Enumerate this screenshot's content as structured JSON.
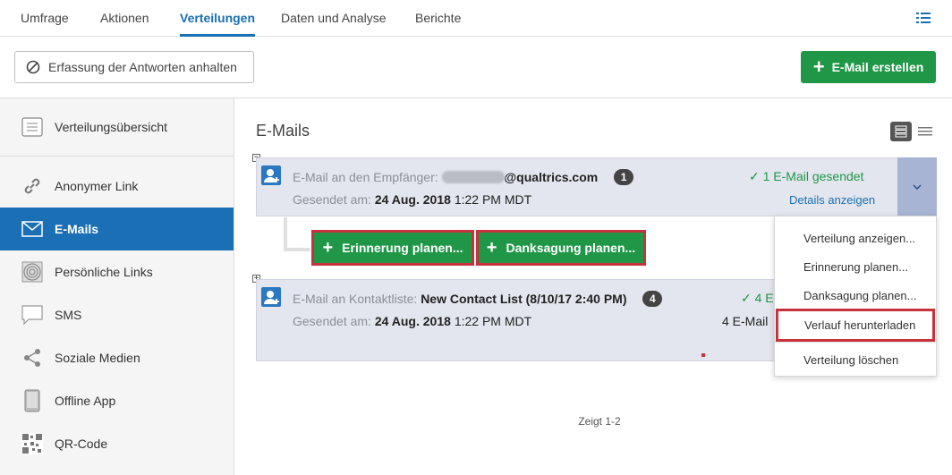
{
  "topnav": {
    "tabs": [
      {
        "label": "Umfrage"
      },
      {
        "label": "Aktionen"
      },
      {
        "label": "Verteilungen"
      },
      {
        "label": "Daten und Analyse"
      },
      {
        "label": "Berichte"
      }
    ],
    "active_tab": "Verteilungen"
  },
  "actionbar": {
    "stop_label": "Erfassung der Antworten anhalten",
    "create_label": "E-Mail erstellen"
  },
  "sidebar": {
    "items": [
      {
        "label": "Verteilungsübersicht",
        "icon": "document-list-icon"
      },
      {
        "label": "Anonymer Link",
        "icon": "link-icon"
      },
      {
        "label": "E-Mails",
        "icon": "envelope-icon",
        "active": true
      },
      {
        "label": "Persönliche Links",
        "icon": "fingerprint-icon"
      },
      {
        "label": "SMS",
        "icon": "chat-bubble-icon"
      },
      {
        "label": "Soziale Medien",
        "icon": "share-icon"
      },
      {
        "label": "Offline App",
        "icon": "tablet-icon"
      },
      {
        "label": "QR-Code",
        "icon": "qr-code-icon"
      }
    ]
  },
  "main": {
    "title": "E-Mails",
    "cards": [
      {
        "recipient_prefix": "E-Mail an den Empfänger:",
        "recipient_value": "@qualtrics.com",
        "count": "1",
        "sent_prefix": "Gesendet am:",
        "sent_value": "24 Aug. 2018",
        "sent_time": "1:22 PM MDT",
        "status": "✓ 1 E-Mail gesendet",
        "details": "Details anzeigen"
      },
      {
        "recipient_prefix": "E-Mail an Kontaktliste:",
        "recipient_value": "New Contact List (8/10/17 2:40 PM)",
        "count": "4",
        "sent_prefix": "Gesendet am:",
        "sent_value": "24 Aug. 2018",
        "sent_time": "1:22 PM MDT",
        "status": "✓ 4 E",
        "status2": "4 E-Mail"
      }
    ],
    "reminder_label": "Erinnerung planen...",
    "thankyou_label": "Danksagung planen...",
    "footer": "Zeigt 1-2"
  },
  "menu": {
    "items": [
      {
        "label": "Verteilung anzeigen..."
      },
      {
        "label": "Erinnerung planen..."
      },
      {
        "label": "Danksagung planen..."
      },
      {
        "label": "Verlauf herunterladen",
        "highlighted": true
      },
      {
        "label": "Verteilung löschen"
      }
    ]
  },
  "colors": {
    "accent": "#1a6fb5",
    "green": "#1f9747",
    "highlight_red": "#c8323c",
    "card_bg": "#e3e6ee"
  }
}
